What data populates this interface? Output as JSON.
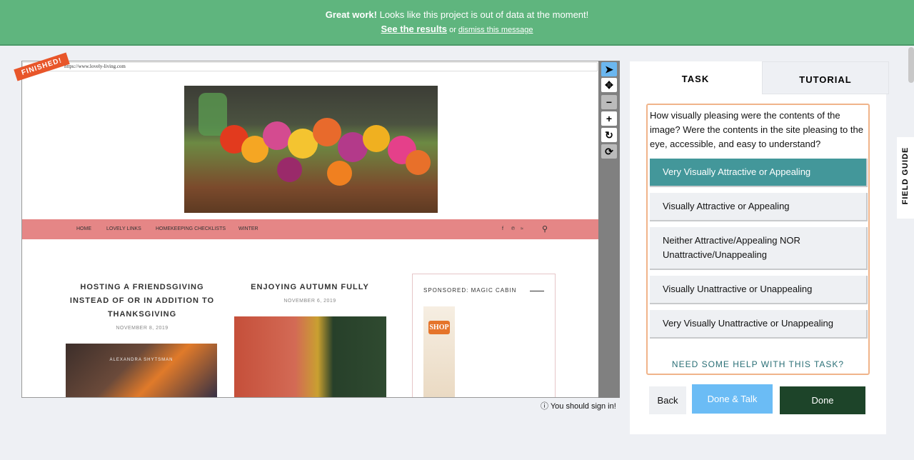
{
  "banner": {
    "bold": "Great work!",
    "message": " Looks like this project is out of data at the moment!",
    "results_link": "See the results",
    "or": " or ",
    "dismiss_link": "dismiss this message"
  },
  "viewer": {
    "badge": "FINISHED!",
    "url": "https://www.lovely-living.com",
    "nav": [
      "HOME",
      "LOVELY LINKS",
      "HOMEKEEPING CHECKLISTS",
      "WINTER"
    ],
    "social": [
      "f",
      "℗",
      "≈"
    ],
    "posts": [
      {
        "title": "HOSTING A FRIENDSGIVING INSTEAD OF OR IN ADDITION TO THANKSGIVING",
        "date": "NOVEMBER 8, 2019",
        "image_caption": "ALEXANDRA SHYTSMAN"
      },
      {
        "title": "ENJOYING AUTUMN FULLY",
        "date": "NOVEMBER 6, 2019"
      }
    ],
    "ad": {
      "title": "SPONSORED: MAGIC CABIN",
      "button": "SHOP"
    },
    "signin": "You should sign in!"
  },
  "panel": {
    "tabs": [
      "TASK",
      "TUTORIAL"
    ],
    "question": "How visually pleasing were the contents of the image? Were the contents in the site pleasing to the eye, accessible, and easy to understand?",
    "options": [
      "Very Visually Attractive or Appealing",
      "Visually Attractive or Appealing",
      "Neither Attractive/Appealing NOR Unattractive/Unappealing",
      "Visually Unattractive or Unappealing",
      "Very Visually Unattractive or Unappealing"
    ],
    "help": "NEED SOME HELP WITH THIS TASK?",
    "buttons": {
      "back": "Back",
      "done_talk": "Done & Talk",
      "done": "Done"
    }
  },
  "field_guide": "FIELD GUIDE",
  "colors": {
    "banner": "#5fb57e",
    "selected": "#43979a",
    "done": "#1d4429",
    "done_talk": "#6bbcf5",
    "nav": "#e58686"
  }
}
